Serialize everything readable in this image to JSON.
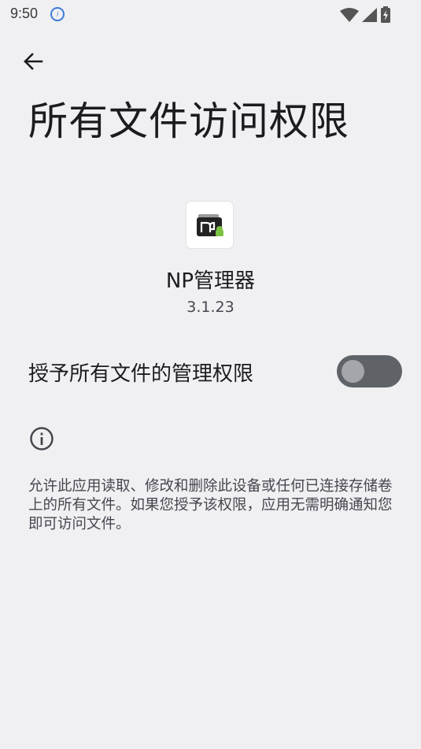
{
  "status_bar": {
    "time": "9:50"
  },
  "header": {
    "title": "所有文件访问权限"
  },
  "app": {
    "name": "NP管理器",
    "version": "3.1.23"
  },
  "permission": {
    "label": "授予所有文件的管理权限",
    "enabled": false
  },
  "info": {
    "description": "允许此应用读取、修改和删除此设备或任何已连接存储卷上的所有文件。如果您授予该权限，应用无需明确通知您即可访问文件。"
  },
  "icons": {
    "back": "arrow-back-icon",
    "info": "info-icon",
    "vpn": "vpn-shield-icon",
    "wifi": "wifi-icon",
    "signal": "cell-signal-icon",
    "battery": "battery-charging-icon"
  },
  "colors": {
    "background": "#f0f0f3",
    "toggle_track": "#5f6368",
    "toggle_thumb": "#a3a6ab"
  }
}
